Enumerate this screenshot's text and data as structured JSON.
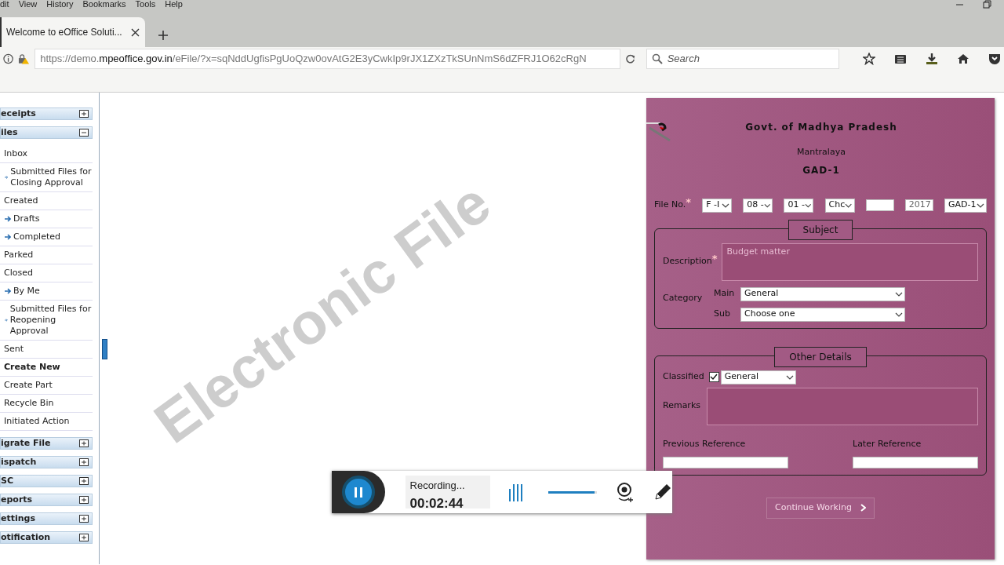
{
  "browser": {
    "menu": [
      "dit",
      "View",
      "History",
      "Bookmarks",
      "Tools",
      "Help"
    ],
    "tabs": [
      {
        "title": "Welcome to eOffice Soluti...",
        "selected": true
      }
    ],
    "address": {
      "prefix": "https://demo.",
      "domain": "mpeoffice.gov.in",
      "path": "/eFile/?x=sqNddUgfisPgUoQzw0ovAtG2E3yCwkIp9rJX1ZXzTkSUnNmS6dZFRJ1O62cRgN"
    },
    "search": {
      "placeholder": "Search"
    }
  },
  "sidebar": {
    "groups": [
      {
        "title": "eceipts",
        "expanded": false
      },
      {
        "title": "iles",
        "expanded": true,
        "items": [
          {
            "label": "Inbox",
            "selected": false,
            "children": [
              {
                "label": "Submitted Files for Closing Approval",
                "selected": false
              }
            ]
          },
          {
            "label": "Created",
            "selected": false,
            "children": [
              {
                "label": "Drafts",
                "selected": false
              },
              {
                "label": "Completed",
                "selected": false
              }
            ]
          },
          {
            "label": "Parked",
            "selected": false
          },
          {
            "label": "Closed",
            "selected": false,
            "children": [
              {
                "label": "By Me",
                "selected": false
              },
              {
                "label": "Submitted Files for Reopening Approval",
                "selected": false
              }
            ]
          },
          {
            "label": "Sent",
            "selected": false
          },
          {
            "label": "Create New",
            "selected": true
          },
          {
            "label": "Create Part",
            "selected": false
          },
          {
            "label": "Recycle Bin",
            "selected": false
          },
          {
            "label": "Initiated Action",
            "selected": false
          }
        ]
      },
      {
        "title": "igrate File",
        "expanded": false
      },
      {
        "title": "ispatch",
        "expanded": false
      },
      {
        "title": "SC",
        "expanded": false
      },
      {
        "title": "eports",
        "expanded": false
      },
      {
        "title": "ettings",
        "expanded": false
      },
      {
        "title": "otification",
        "expanded": false
      }
    ]
  },
  "watermark": "Electronic File",
  "form": {
    "organisation": "Govt. of Madhya Pradesh",
    "department": "Mantralaya",
    "section": "GAD-1",
    "file_no": {
      "label": "File No.",
      "required_mark": "*",
      "parts": [
        {
          "kind": "select",
          "value": "F -I"
        },
        {
          "kind": "select",
          "value": "08 -"
        },
        {
          "kind": "select",
          "value": "01 -"
        },
        {
          "kind": "select",
          "value": "Chc"
        },
        {
          "kind": "input"
        },
        {
          "kind": "input",
          "value": "2017"
        },
        {
          "kind": "select",
          "value": "GAD-1"
        }
      ]
    },
    "subject": {
      "legend": "Subject",
      "description_label": "Description",
      "description_required_mark": "*",
      "description_placeholder": "Budget matter",
      "category_label": "Category",
      "main_label": "Main",
      "main_value": "General",
      "sub_label": "Sub",
      "sub_value": "Choose one"
    },
    "other": {
      "legend": "Other Details",
      "classified_label": "Classified",
      "classified": true,
      "classified_value": "General",
      "remarks_label": "Remarks",
      "previous_label": "Previous Reference",
      "later_label": "Later Reference"
    },
    "button": "Continue Working"
  },
  "recorder": {
    "status": "Recording...",
    "time": "00:02:44",
    "volume": {
      "level": 0.95
    }
  }
}
